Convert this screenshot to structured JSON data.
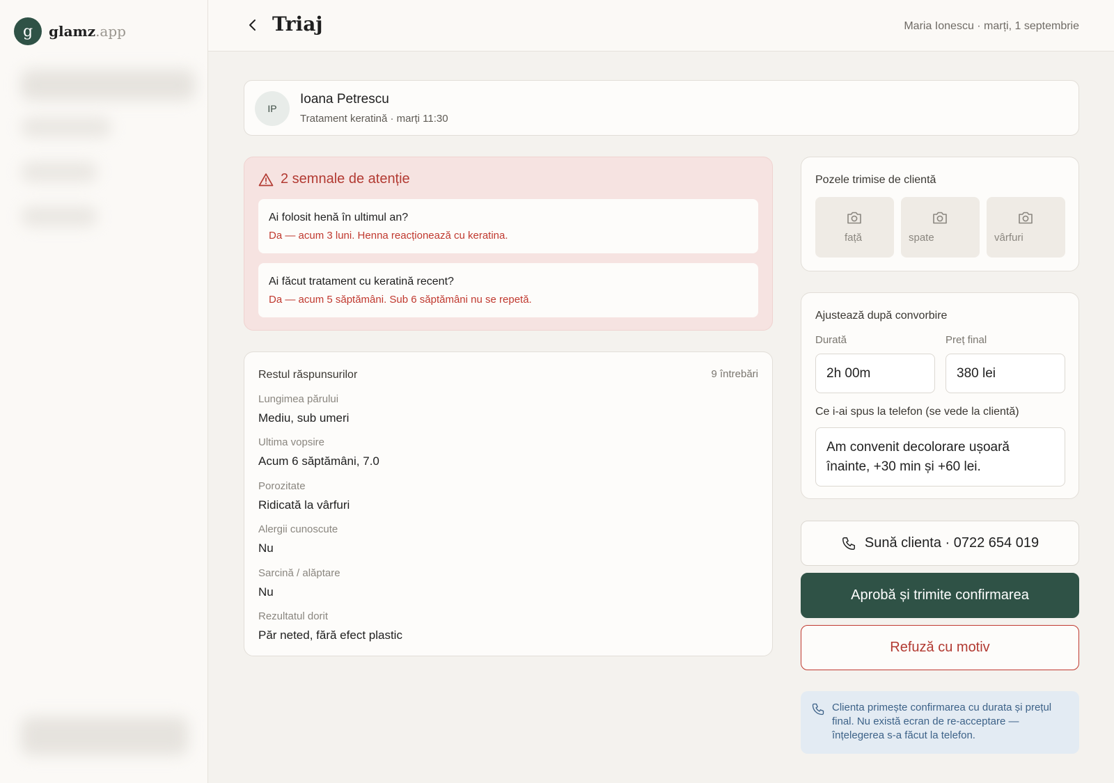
{
  "brand": {
    "mark": "g",
    "name": "glamz",
    "suffix": ".app"
  },
  "header": {
    "back_label": "‹",
    "title": "Triaj",
    "meta": "Maria Ionescu · marți, 1 septembrie"
  },
  "client": {
    "initials": "IP",
    "name": "Ioana Petrescu",
    "subtitle": "Tratament keratină · marți 11:30"
  },
  "alerts": {
    "title": "2 semnale de atenție",
    "items": [
      {
        "question": "Ai folosit henă în ultimul an?",
        "answer": "Da — acum 3 luni. Henna reacționează cu keratina."
      },
      {
        "question": "Ai făcut tratament cu keratină recent?",
        "answer": "Da — acum 5 săptămâni. Sub 6 săptămâni nu se repetă."
      }
    ]
  },
  "answers": {
    "title": "Restul răspunsurilor",
    "count": "9 întrebări",
    "items": [
      {
        "label": "Lungimea părului",
        "value": "Mediu, sub umeri"
      },
      {
        "label": "Ultima vopsire",
        "value": "Acum 6 săptămâni, 7.0"
      },
      {
        "label": "Porozitate",
        "value": "Ridicată la vârfuri"
      },
      {
        "label": "Alergii cunoscute",
        "value": "Nu"
      },
      {
        "label": "Sarcină / alăptare",
        "value": "Nu"
      },
      {
        "label": "Rezultatul dorit",
        "value": "Păr neted, fără efect plastic"
      }
    ]
  },
  "photos": {
    "title": "Pozele trimise de clientă",
    "items": [
      "față",
      "spate",
      "vârfuri"
    ]
  },
  "adjust": {
    "title": "Ajustează după convorbire",
    "duration_label": "Durată",
    "duration_value": "2h 00m",
    "price_label": "Preț final",
    "price_value": "380 lei",
    "note_label": "Ce i-ai spus la telefon (se vede la clientă)",
    "note_value": "Am convenit decolorare ușoară înainte, +30 min și +60 lei."
  },
  "actions": {
    "call": "Sună clienta · 0722 654 019",
    "approve": "Aprobă și trimite confirmarea",
    "refuse": "Refuză cu motiv"
  },
  "info_note": "Clienta primește confirmarea cu durata și prețul final. Nu există ecran de re-acceptare — înțelegerea s-a făcut la telefon.",
  "colors": {
    "accent": "#2f5246",
    "danger": "#b23a32",
    "alert_bg": "#f6e3e1",
    "info_bg": "#e3ebf3",
    "info_text": "#3d6288"
  },
  "icons": [
    "chevron-left-icon",
    "warning-triangle-icon",
    "camera-icon",
    "phone-icon"
  ]
}
